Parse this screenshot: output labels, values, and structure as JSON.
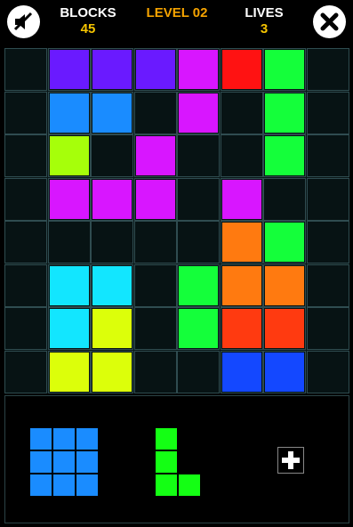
{
  "header": {
    "blocks_label": "BLOCKS",
    "blocks_value": "45",
    "level_label": "LEVEL 02",
    "lives_label": "LIVES",
    "lives_value": "3",
    "sound_button_icon": "speaker-muted-icon",
    "close_button_icon": "close-x-icon"
  },
  "colors": {
    "purple": "#6a1aff",
    "blue": "#1a8cff",
    "magenta": "#d816ff",
    "red": "#ff1212",
    "green": "#14ff3a",
    "lime": "#a6ff0a",
    "orange": "#ff7a10",
    "cyan": "#12e6ff",
    "yellow": "#dcff0a",
    "redorange": "#ff3a10",
    "royal": "#1448ff",
    "tray_blue": "#1a8cff",
    "tray_green": "#14ff14"
  },
  "board": {
    "rows": 8,
    "cols": 8,
    "grid": [
      [
        null,
        "purple",
        "purple",
        "purple",
        "magenta",
        "red",
        "green",
        null
      ],
      [
        null,
        "blue",
        "blue",
        null,
        "magenta",
        null,
        "green",
        null
      ],
      [
        null,
        "lime",
        null,
        "magenta",
        null,
        null,
        "green",
        null
      ],
      [
        null,
        "magenta",
        "magenta",
        "magenta",
        null,
        "magenta",
        null,
        null
      ],
      [
        null,
        null,
        null,
        null,
        null,
        "orange",
        "green",
        null
      ],
      [
        null,
        "cyan",
        "cyan",
        null,
        "green",
        "orange",
        "orange",
        null
      ],
      [
        null,
        "cyan",
        "yellow",
        null,
        "green",
        "redorange",
        "redorange",
        null
      ],
      [
        null,
        "yellow",
        "yellow",
        null,
        null,
        "royal",
        "royal",
        null
      ]
    ]
  },
  "tray": {
    "pieces": [
      {
        "name": "square-3x3",
        "color": "tray_blue",
        "cells": [
          [
            0,
            0
          ],
          [
            0,
            1
          ],
          [
            0,
            2
          ],
          [
            1,
            0
          ],
          [
            1,
            1
          ],
          [
            1,
            2
          ],
          [
            2,
            0
          ],
          [
            2,
            1
          ],
          [
            2,
            2
          ]
        ]
      },
      {
        "name": "l-shape",
        "color": "tray_green",
        "cells": [
          [
            0,
            0
          ],
          [
            1,
            0
          ],
          [
            2,
            0
          ],
          [
            2,
            1
          ]
        ]
      }
    ],
    "extra_button_icon": "plus-icon"
  }
}
